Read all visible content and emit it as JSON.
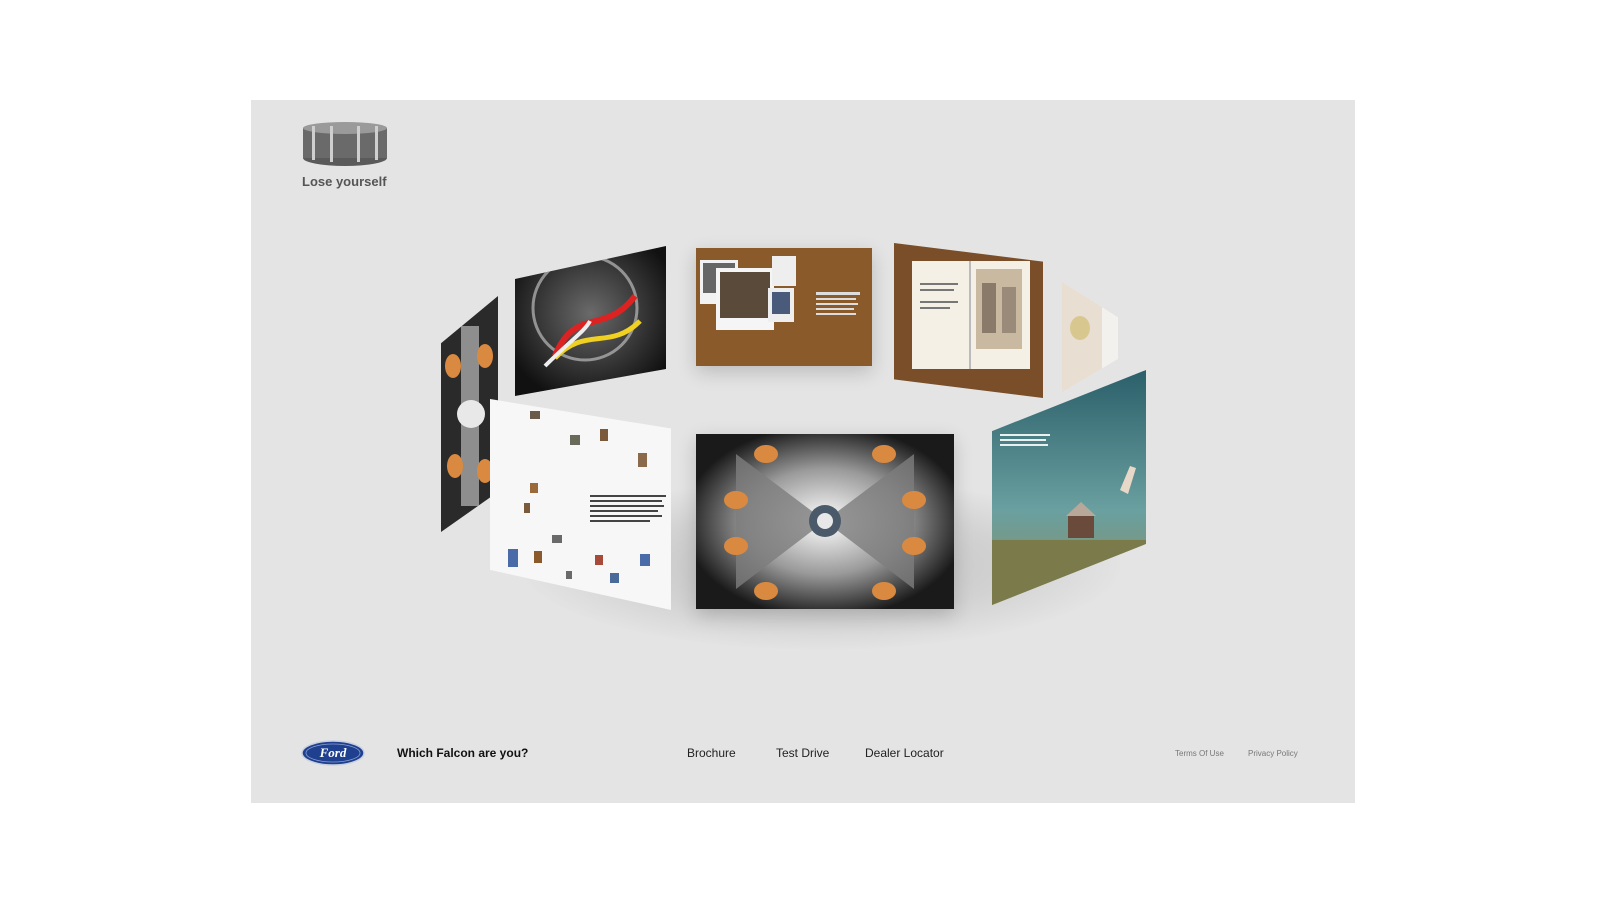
{
  "brand": {
    "tagline": "Lose yourself",
    "logo_icon": "carousel-ring-icon"
  },
  "footer": {
    "title": "Which Falcon are you?",
    "ford_logo_text": "Ford",
    "nav": [
      "Brochure",
      "Test Drive",
      "Dealer Locator"
    ],
    "legal": [
      "Terms Of Use",
      "Privacy Policy"
    ]
  },
  "colors": {
    "stage_bg": "#e4e4e4",
    "ford_blue": "#1f3f8f",
    "wood": "#8b5a2b",
    "sky": "#3d7e86"
  }
}
